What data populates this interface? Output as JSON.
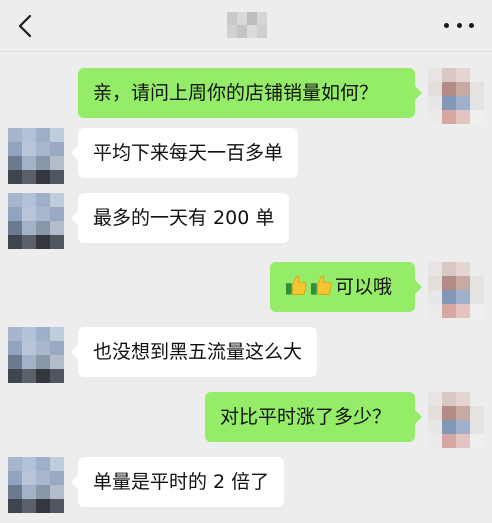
{
  "header": {
    "back_icon": "chevron-left-icon",
    "title": "",
    "more_icon": "more-dots-icon"
  },
  "messages": [
    {
      "side": "out",
      "text": "亲，请问上周你的店铺销量如何？"
    },
    {
      "side": "in",
      "text": "平均下来每天一百多单"
    },
    {
      "side": "in",
      "text": "最多的一天有 200 单"
    },
    {
      "side": "out",
      "text": "可以哦",
      "emoji": [
        "thumbs-up-icon",
        "thumbs-up-icon"
      ]
    },
    {
      "side": "in",
      "text": "也没想到黑五流量这么大"
    },
    {
      "side": "out",
      "text": "对比平时涨了多少？"
    },
    {
      "side": "in",
      "text": "单量是平时的 2 倍了"
    }
  ],
  "colors": {
    "background": "#ededed",
    "outgoing_bubble": "#95ec69",
    "incoming_bubble": "#ffffff"
  }
}
